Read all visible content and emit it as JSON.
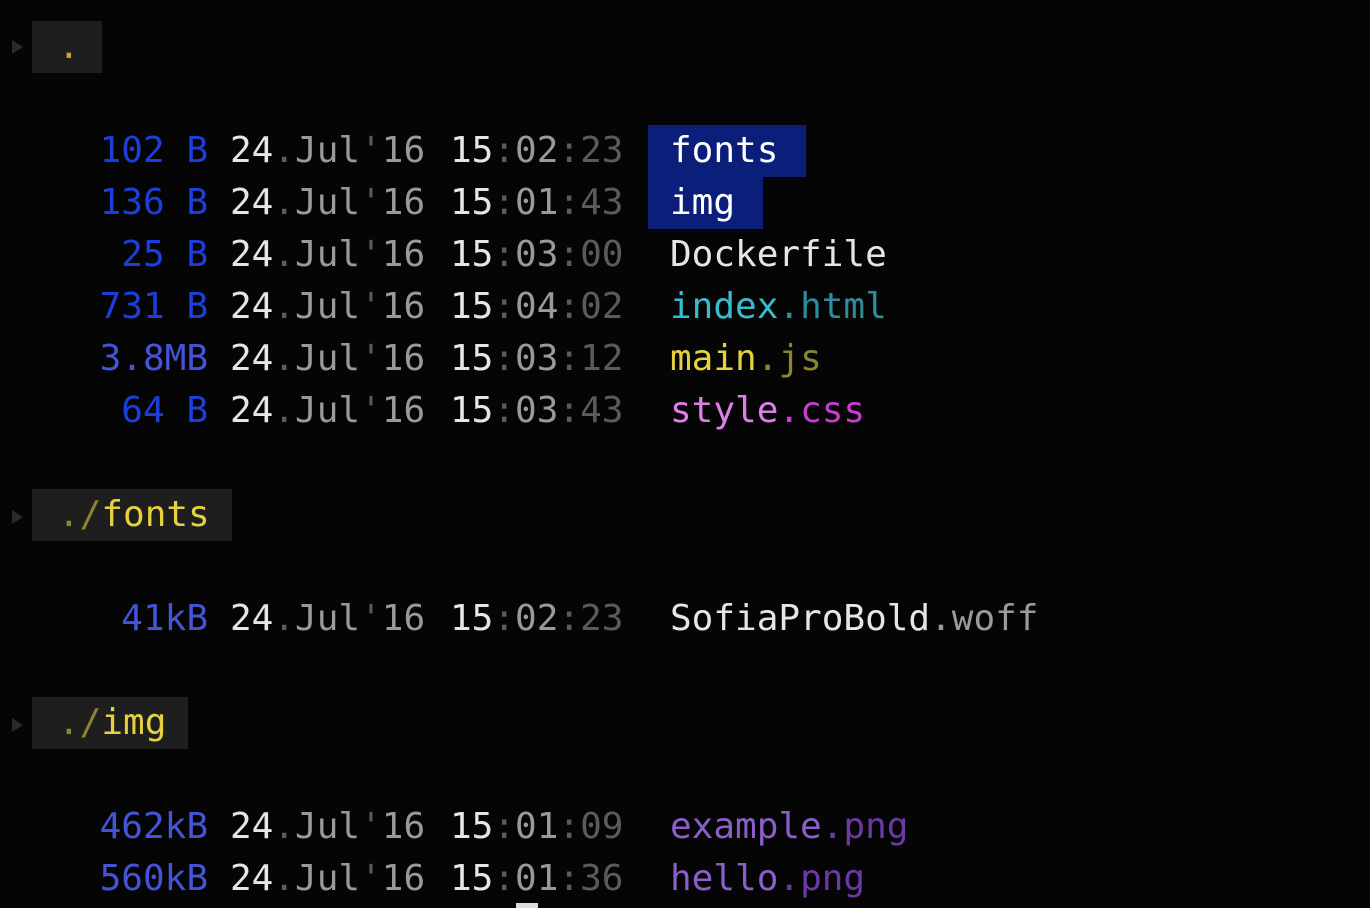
{
  "sections": [
    {
      "header": {
        "prefix": "",
        "name": "."
      },
      "rows": [
        {
          "size_num": "102",
          "size_unit": " B",
          "day": "24",
          "month": "Jul",
          "year": "16",
          "hh": "15",
          "mm": "02",
          "ss": "23",
          "name": "fonts",
          "ext": "",
          "kind": "dir"
        },
        {
          "size_num": "136",
          "size_unit": " B",
          "day": "24",
          "month": "Jul",
          "year": "16",
          "hh": "15",
          "mm": "01",
          "ss": "43",
          "name": "img",
          "ext": "",
          "kind": "dir"
        },
        {
          "size_num": "25",
          "size_unit": " B",
          "day": "24",
          "month": "Jul",
          "year": "16",
          "hh": "15",
          "mm": "03",
          "ss": "00",
          "name": "Dockerfile",
          "ext": "",
          "kind": "plain"
        },
        {
          "size_num": "731",
          "size_unit": " B",
          "day": "24",
          "month": "Jul",
          "year": "16",
          "hh": "15",
          "mm": "04",
          "ss": "02",
          "name": "index",
          "ext": "html",
          "kind": "html"
        },
        {
          "size_num": "3.8",
          "size_unit": "MB",
          "day": "24",
          "month": "Jul",
          "year": "16",
          "hh": "15",
          "mm": "03",
          "ss": "12",
          "name": "main",
          "ext": "js",
          "kind": "js"
        },
        {
          "size_num": "64",
          "size_unit": " B",
          "day": "24",
          "month": "Jul",
          "year": "16",
          "hh": "15",
          "mm": "03",
          "ss": "43",
          "name": "style",
          "ext": "css",
          "kind": "css"
        }
      ]
    },
    {
      "header": {
        "prefix": "./",
        "name": "fonts"
      },
      "rows": [
        {
          "size_num": "41",
          "size_unit": "kB",
          "day": "24",
          "month": "Jul",
          "year": "16",
          "hh": "15",
          "mm": "02",
          "ss": "23",
          "name": "SofiaProBold",
          "ext": "woff",
          "kind": "font"
        }
      ]
    },
    {
      "header": {
        "prefix": "./",
        "name": "img"
      },
      "rows": [
        {
          "size_num": "462",
          "size_unit": "kB",
          "day": "24",
          "month": "Jul",
          "year": "16",
          "hh": "15",
          "mm": "01",
          "ss": "09",
          "name": "example",
          "ext": "png",
          "kind": "png"
        },
        {
          "size_num": "560",
          "size_unit": "kB",
          "day": "24",
          "month": "Jul",
          "year": "16",
          "hh": "15",
          "mm": "01",
          "ss": "36",
          "name": "hello",
          "ext": "png",
          "kind": "png"
        }
      ]
    }
  ],
  "separators": {
    "date_dot": ".",
    "year_tick": "'",
    "time_colon": ":",
    "ext_dot": "."
  },
  "colors": {
    "size_blue": "#1c3fdc",
    "dir_highlight": "#0b1f7a",
    "header_bg": "#1e1e1e",
    "header_name": "#e5d23c",
    "background": "#050505"
  }
}
